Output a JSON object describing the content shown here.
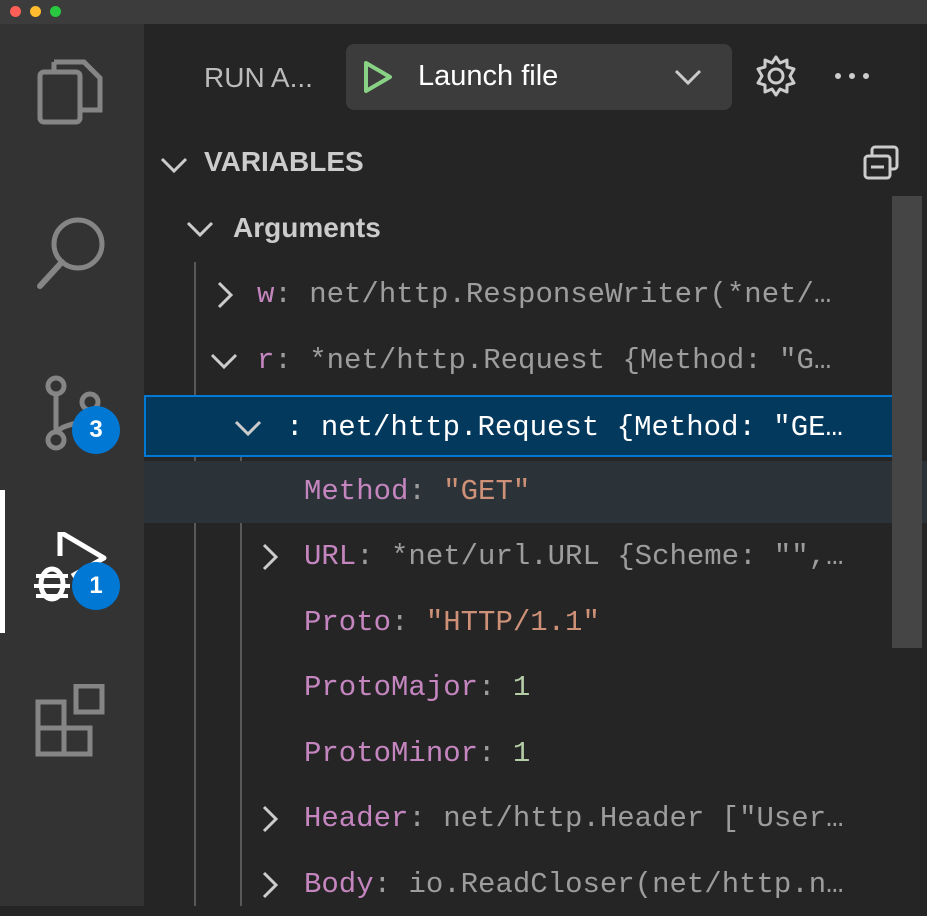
{
  "sidebar": {
    "title": "RUN A...",
    "launch_config": "Launch file",
    "section_title": "VARIABLES",
    "scope_label": "Arguments"
  },
  "activity_bar": {
    "scm_badge": "3",
    "debug_badge": "1"
  },
  "variables": [
    {
      "name": "w",
      "sep": ": ",
      "value": "net/http.ResponseWriter(*net/…",
      "value_kind": "plain",
      "expandable": true,
      "expanded": false
    },
    {
      "name": "r",
      "sep": ": ",
      "value": "*net/http.Request {Method: \"G…",
      "value_kind": "plain",
      "expandable": true,
      "expanded": true
    },
    {
      "name": "",
      "sep": ": ",
      "value": "net/http.Request {Method: \"GE…",
      "value_kind": "selected",
      "expandable": true,
      "expanded": true
    },
    {
      "name": "Method",
      "sep": ": ",
      "value": "\"GET\"",
      "value_kind": "string",
      "expandable": false
    },
    {
      "name": "URL",
      "sep": ": ",
      "value": "*net/url.URL {Scheme: \"\",…",
      "value_kind": "plain",
      "expandable": true,
      "expanded": false
    },
    {
      "name": "Proto",
      "sep": ": ",
      "value": "\"HTTP/1.1\"",
      "value_kind": "string",
      "expandable": false
    },
    {
      "name": "ProtoMajor",
      "sep": ": ",
      "value": "1",
      "value_kind": "number",
      "expandable": false
    },
    {
      "name": "ProtoMinor",
      "sep": ": ",
      "value": "1",
      "value_kind": "number",
      "expandable": false
    },
    {
      "name": "Header",
      "sep": ": ",
      "value": "net/http.Header [\"User…",
      "value_kind": "plain",
      "expandable": true,
      "expanded": false
    },
    {
      "name": "Body",
      "sep": ": ",
      "value": "io.ReadCloser(net/http.n…",
      "value_kind": "plain",
      "expandable": true,
      "expanded": false
    }
  ],
  "colors": {
    "activity_bg": "#333333",
    "sidebar_bg": "#252526",
    "selection_bg": "#04395e",
    "selection_border": "#0078d4",
    "badge": "#0078d4",
    "var_name": "#c586c0",
    "string": "#ce9178",
    "number": "#b5cea8",
    "run_icon": "#89d185"
  }
}
